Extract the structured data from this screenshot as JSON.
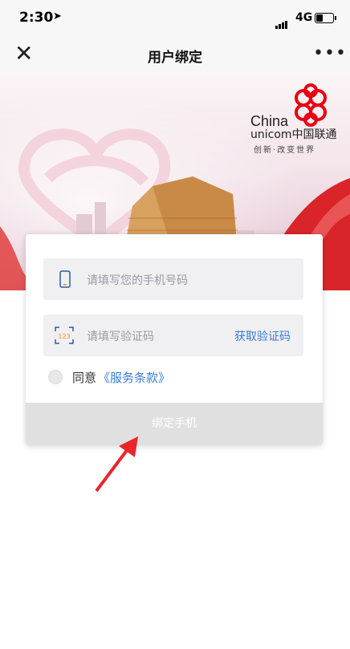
{
  "status": {
    "time": "2:30",
    "network": "4G"
  },
  "nav": {
    "title": "用户绑定",
    "close": "✕",
    "more": "•••"
  },
  "banner": {
    "brand_en_1": "China",
    "brand_en_2": "unicom",
    "brand_cn": "中国联通",
    "slogan": "创新·改变世界"
  },
  "form": {
    "phone_placeholder": "请填写您的手机号码",
    "code_icon_text": "123",
    "code_placeholder": "请填写验证码",
    "get_code": "获取验证码",
    "agree": "同意",
    "terms": "《服务条款》",
    "bind_button": "绑定手机"
  },
  "colors": {
    "accent": "#3a7bd5",
    "brand_red": "#e60012",
    "arrow": "#e8262b"
  }
}
